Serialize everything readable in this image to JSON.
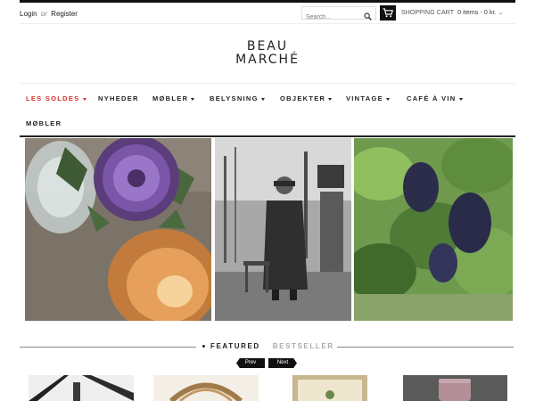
{
  "header": {
    "login_label": "Login",
    "or_label": "or",
    "register_label": "Register",
    "search_placeholder": "Search...",
    "cart_label": "SHOPPING CART",
    "cart_items": "0 items - 0 kr."
  },
  "brand": {
    "line1": "BEAU",
    "line2": "MARCHÉ"
  },
  "nav": {
    "items": [
      {
        "label": "LES SOLDES",
        "dropdown": true,
        "active": true
      },
      {
        "label": "NYHEDER",
        "dropdown": false
      },
      {
        "label": "MØBLER",
        "dropdown": true
      },
      {
        "label": "BELYSNING",
        "dropdown": true
      },
      {
        "label": "OBJEKTER",
        "dropdown": true
      },
      {
        "label": "VINTAGE",
        "dropdown": true
      },
      {
        "label": "CAFÉ À VIN",
        "dropdown": true
      },
      {
        "label": "MØBLER",
        "dropdown": false
      }
    ]
  },
  "featured": {
    "tab_featured": "FEATURED",
    "tab_bestseller": "BESTSELLER",
    "prev_label": "Prev",
    "next_label": "Next"
  },
  "colors": {
    "accent": "#d0312d",
    "dark": "#111111",
    "muted": "#aaaaaa"
  },
  "icons": {
    "search": "search-icon",
    "cart": "cart-icon",
    "chevron": "chevron-down-icon"
  }
}
